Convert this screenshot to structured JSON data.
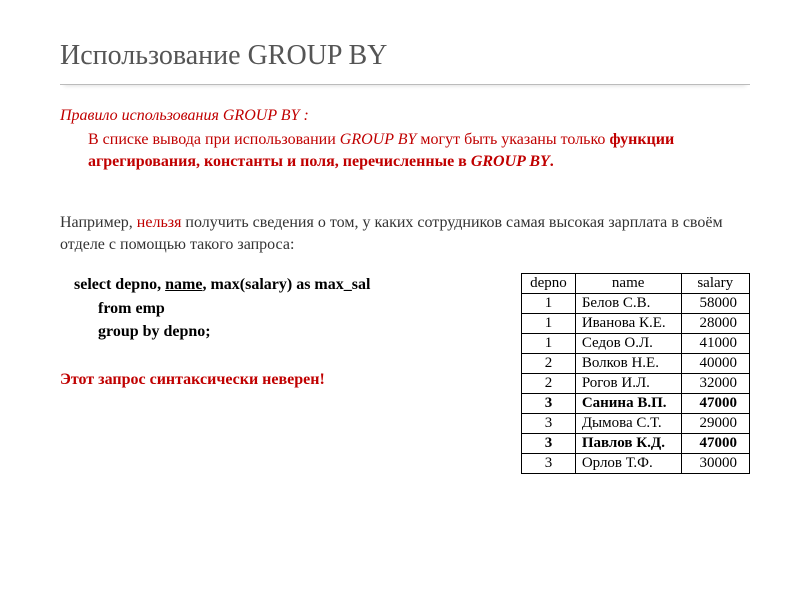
{
  "title": "Использование GROUP BY",
  "rule": {
    "heading": "Правило использования GROUP BY :",
    "body_pre": "В списке вывода при использовании ",
    "body_gb1": "GROUP BY",
    "body_mid": " могут быть указаны только ",
    "body_bold": "функции агрегирования, константы и поля, перечисленные в ",
    "body_gb2": "GROUP BY",
    "body_end": "."
  },
  "example": {
    "intro_pre": "Например, ",
    "intro_red": "нельзя",
    "intro_post": " получить сведения о том, у каких сотрудников самая высокая зарплата в своём отделе с помощью такого запроса:"
  },
  "sql": {
    "l1_a": "select  depno,  ",
    "l1_name": "name",
    "l1_b": ",  max(salary) as max_sal",
    "l2": "from  emp",
    "l3": "group by  depno;"
  },
  "error": "Этот запрос синтаксически неверен!",
  "table": {
    "headers": {
      "c1": "depno",
      "c2": "name",
      "c3": "salary"
    },
    "rows": [
      {
        "depno": "1",
        "name": "Белов С.В.",
        "salary": "58000",
        "bold": false
      },
      {
        "depno": "1",
        "name": "Иванова К.Е.",
        "salary": "28000",
        "bold": false
      },
      {
        "depno": "1",
        "name": "Седов О.Л.",
        "salary": "41000",
        "bold": false
      },
      {
        "depno": "2",
        "name": "Волков Н.Е.",
        "salary": "40000",
        "bold": false
      },
      {
        "depno": "2",
        "name": "Рогов И.Л.",
        "salary": "32000",
        "bold": false
      },
      {
        "depno": "3",
        "name": "Санина В.П.",
        "salary": "47000",
        "bold": true
      },
      {
        "depno": "3",
        "name": "Дымова С.Т.",
        "salary": "29000",
        "bold": false
      },
      {
        "depno": "3",
        "name": "Павлов К.Д.",
        "salary": "47000",
        "bold": true
      },
      {
        "depno": "3",
        "name": "Орлов Т.Ф.",
        "salary": "30000",
        "bold": false
      }
    ]
  }
}
